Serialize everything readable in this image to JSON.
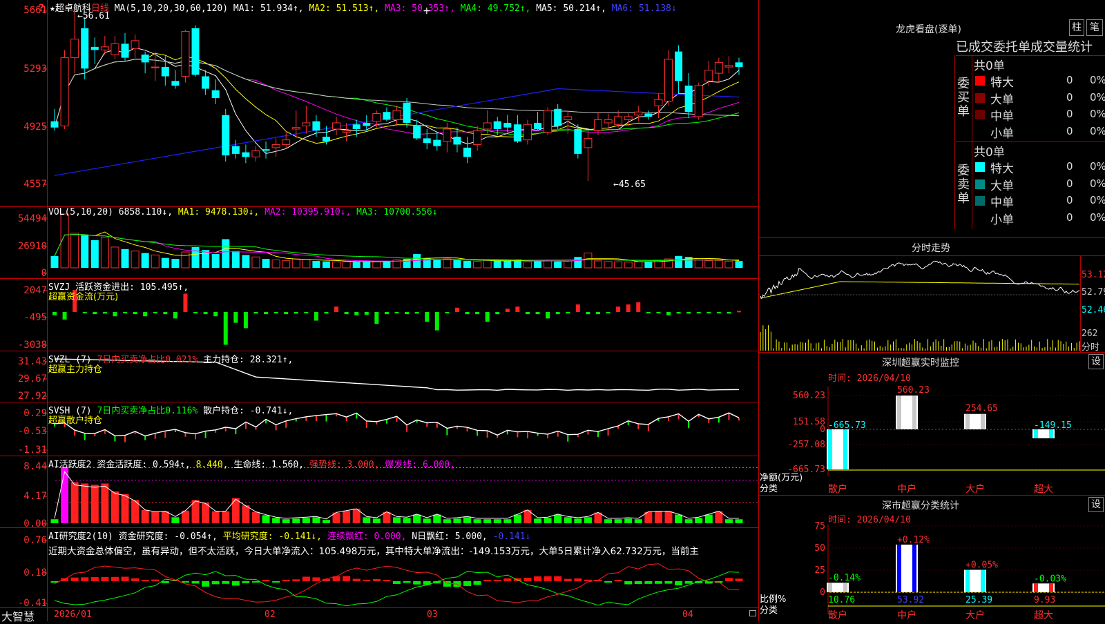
{
  "stock": {
    "star": "★",
    "name": "超卓航科",
    "period": "日线",
    "ma_label": "MA(5,10,20,30,60,120)",
    "ma1": "MA1: 51.934↑,",
    "ma2": "MA2: 51.513↑,",
    "ma3": "MA3: 50.353↑,",
    "ma4": "MA4: 49.752↑,",
    "ma5": "MA5: 50.214↑,",
    "ma6": "MA6: 51.138↓",
    "high_mark": "←56.61",
    "low_mark": "←45.65",
    "plus": "+"
  },
  "axes": {
    "price": [
      "5661",
      "5293",
      "4925",
      "4557"
    ],
    "vol": [
      "54494",
      "26910",
      "0"
    ],
    "svzj": [
      "2047",
      "-495",
      "-3038"
    ],
    "svzl": [
      "31.43",
      "29.67",
      "27.92"
    ],
    "svsh": [
      "0.29",
      "-0.53",
      "-1.31"
    ],
    "active": [
      "8.44",
      "4.17",
      "0.00"
    ],
    "research": [
      "0.76",
      "0.18",
      "-0.41"
    ]
  },
  "vol": {
    "label": "VOL(5,10,20)",
    "value": "6858.110↓,",
    "ma1": "MA1: 9478.130↓,",
    "ma2": "MA2: 10395.910↓,",
    "ma3": "MA3: 10700.556↓"
  },
  "svzj": {
    "label": "SVZJ",
    "text": "活跃资金进出: 105.495↑,",
    "sub": "超赢资金流(万元)"
  },
  "svzl": {
    "label": "SVZL (7)",
    "text1": "7日内买卖净占比0.021%",
    "text2": "主力持仓: 28.321↑,",
    "sub": "超赢主力持仓"
  },
  "svsh": {
    "label": "SVSH (7)",
    "text1": "7日内买卖净占比0.116%",
    "text2": "散户持仓: -0.741↓,",
    "sub": "超赢散户持仓"
  },
  "active": {
    "label": "AI活跃度2",
    "t1": "资金活跃度: 0.594↑,",
    "t2": "8.440,",
    "t3": "生命线: 1.560,",
    "t4": "强势线: 3.000,",
    "t5": "爆发线: 6.000,"
  },
  "research": {
    "label": "AI研究度2(10)",
    "t1": "资金研究度: -0.054↑,",
    "t2": "平均研究度: -0.141↓,",
    "t3": "连续飘红: 0.000,",
    "t4": "N日飘红: 5.000,",
    "t5": "-0.141↓",
    "comment": "近期大资金总体偏空，虽有异动，但不太活跃，今日大单净流入：105.498万元，其中特大单净流出：-149.153万元，大单5日累计净入62.732万元，当前主"
  },
  "dates": [
    "2026/01",
    "02",
    "03",
    "04"
  ],
  "brand": "大智慧",
  "right": {
    "dragon_title": "龙虎看盘(逐单)",
    "btn_zhu": "柱",
    "btn_bi": "笔",
    "deal_title": "已成交委托单成交量统计",
    "buy_side": "委买单",
    "sell_side": "委卖单",
    "buy_total": "共0单",
    "sell_total": "共0单",
    "buy_rows": [
      {
        "label": "特大",
        "count": "0",
        "pct": "0%",
        "color": "#ff0000"
      },
      {
        "label": "大单",
        "count": "0",
        "pct": "0%",
        "color": "#8b0000"
      },
      {
        "label": "中单",
        "count": "0",
        "pct": "0%",
        "color": "#6b0000"
      },
      {
        "label": "小单",
        "count": "0",
        "pct": "0%",
        "color": ""
      }
    ],
    "sell_rows": [
      {
        "label": "特大",
        "count": "0",
        "pct": "0%",
        "color": "#00ffff"
      },
      {
        "label": "大单",
        "count": "0",
        "pct": "0%",
        "color": "#008b8b"
      },
      {
        "label": "中单",
        "count": "0",
        "pct": "0%",
        "color": "#006b6b"
      },
      {
        "label": "小单",
        "count": "0",
        "pct": "0%",
        "color": ""
      }
    ],
    "intraday_title": "分时走势",
    "intraday_prices": [
      "53.12",
      "52.79",
      "52.46"
    ],
    "intraday_vol": [
      "262",
      "分时"
    ],
    "sz_monitor_title": "深圳超赢实时监控",
    "sz_btn": "设",
    "time_label": "时间: 2026/04/10",
    "mon_axis": [
      "560.23",
      "151.58",
      "0",
      "-257.08",
      "-665.73"
    ],
    "mon_ylabel": [
      "净额(万元)",
      "分类"
    ],
    "mon_cats": [
      "散户",
      "中户",
      "大户",
      "超大"
    ],
    "mon_values": [
      "-665.73",
      "560.23",
      "254.65",
      "-149.15"
    ],
    "cls_title": "深市超赢分类统计",
    "cls_btn": "设",
    "cls_time": "时间: 2026/04/10",
    "cls_axis": [
      "75",
      "50",
      "25",
      "0"
    ],
    "cls_ylabel": [
      "比例%",
      "分类"
    ],
    "cls_cats": [
      "散户",
      "中户",
      "大户",
      "超大"
    ],
    "cls_change": [
      "-0.14%",
      "+0.12%",
      "+0.05%",
      "-0.03%"
    ],
    "cls_values": [
      "10.76",
      "53.92",
      "25.39",
      "9.93"
    ]
  },
  "chart_data": [
    {
      "type": "candlestick",
      "title": "超卓航科 日线",
      "y_ticks": [
        56.61,
        52.93,
        49.25,
        45.57
      ],
      "ohlc": [
        [
          49.5,
          50.3,
          48.9,
          49.1
        ],
        [
          49.2,
          54.1,
          49.0,
          53.6
        ],
        [
          53.6,
          56.61,
          52.6,
          54.8
        ],
        [
          55.5,
          56.2,
          52.2,
          52.9
        ],
        [
          54.3,
          54.9,
          53.2,
          54.1
        ],
        [
          54.1,
          55.0,
          53.8,
          54.3
        ],
        [
          53.8,
          55.0,
          53.5,
          54.5
        ],
        [
          54.5,
          55.2,
          53.4,
          53.6
        ],
        [
          54.2,
          55.1,
          53.6,
          54.7
        ],
        [
          53.8,
          54.0,
          52.6,
          53.3
        ],
        [
          53.0,
          54.0,
          52.1,
          53.0
        ],
        [
          53.0,
          53.7,
          51.8,
          52.4
        ],
        [
          52.1,
          52.8,
          51.6,
          51.8
        ],
        [
          52.4,
          55.4,
          52.0,
          55.3
        ],
        [
          55.5,
          55.7,
          52.4,
          52.5
        ],
        [
          52.4,
          52.8,
          51.2,
          51.6
        ],
        [
          51.5,
          52.2,
          50.6,
          51.0
        ],
        [
          49.9,
          50.3,
          46.9,
          47.3
        ],
        [
          47.9,
          48.3,
          47.1,
          47.4
        ],
        [
          47.5,
          48.0,
          46.8,
          47.2
        ],
        [
          47.2,
          47.9,
          46.9,
          47.6
        ],
        [
          47.7,
          48.2,
          47.1,
          47.6
        ],
        [
          47.8,
          48.4,
          47.2,
          48.0
        ],
        [
          48.0,
          48.9,
          47.8,
          48.3
        ],
        [
          49.0,
          50.2,
          48.4,
          49.1
        ],
        [
          49.2,
          50.5,
          48.7,
          49.4
        ],
        [
          49.5,
          49.9,
          48.5,
          48.9
        ],
        [
          48.5,
          49.2,
          48.0,
          48.2
        ],
        [
          49.0,
          49.8,
          48.6,
          49.4
        ],
        [
          48.8,
          49.4,
          48.2,
          48.9
        ],
        [
          49.3,
          49.6,
          48.5,
          49.0
        ],
        [
          49.4,
          49.9,
          48.9,
          49.2
        ],
        [
          49.5,
          50.2,
          49.1,
          50.0
        ],
        [
          50.1,
          50.4,
          49.5,
          49.6
        ],
        [
          49.6,
          50.5,
          49.2,
          50.2
        ],
        [
          50.7,
          51.0,
          49.1,
          49.4
        ],
        [
          49.2,
          49.6,
          48.3,
          48.4
        ],
        [
          48.4,
          49.0,
          47.7,
          48.1
        ],
        [
          48.3,
          48.8,
          47.6,
          47.9
        ],
        [
          48.2,
          49.4,
          47.5,
          49.0
        ],
        [
          48.5,
          49.1,
          47.5,
          48.0
        ],
        [
          47.8,
          48.5,
          46.8,
          47.2
        ],
        [
          48.0,
          49.2,
          47.6,
          48.9
        ],
        [
          49.0,
          50.2,
          48.7,
          49.4
        ],
        [
          49.5,
          49.8,
          48.6,
          49.0
        ],
        [
          49.4,
          49.9,
          48.8,
          49.1
        ],
        [
          49.3,
          49.9,
          48.1,
          48.2
        ],
        [
          48.3,
          49.6,
          48.0,
          49.3
        ],
        [
          49.4,
          50.1,
          48.9,
          49.0
        ],
        [
          48.8,
          50.4,
          48.6,
          50.2
        ],
        [
          50.3,
          50.6,
          49.0,
          49.2
        ],
        [
          49.6,
          50.2,
          48.7,
          49.8
        ],
        [
          49.0,
          49.3,
          47.1,
          47.4
        ],
        [
          47.8,
          48.9,
          45.65,
          48.4
        ],
        [
          48.9,
          50.1,
          48.6,
          49.6
        ],
        [
          49.4,
          50.0,
          48.9,
          49.6
        ],
        [
          49.3,
          50.2,
          49.1,
          49.8
        ],
        [
          49.6,
          50.0,
          49.2,
          49.8
        ],
        [
          49.9,
          50.5,
          49.5,
          50.1
        ],
        [
          50.0,
          50.2,
          49.6,
          49.8
        ],
        [
          50.5,
          51.3,
          49.7,
          50.9
        ],
        [
          50.8,
          54.1,
          50.5,
          53.5
        ],
        [
          54.0,
          54.4,
          51.3,
          52.1
        ],
        [
          51.8,
          52.6,
          49.7,
          50.1
        ],
        [
          49.8,
          52.0,
          49.6,
          51.8
        ],
        [
          52.1,
          53.4,
          51.8,
          52.8
        ],
        [
          52.6,
          53.6,
          52.0,
          53.3
        ],
        [
          53.0,
          53.7,
          52.6,
          53.1
        ],
        [
          53.3,
          53.6,
          52.5,
          53.0
        ]
      ],
      "ma_series": [
        "MA1",
        "MA2",
        "MA3",
        "MA4",
        "MA5",
        "MA6"
      ]
    },
    {
      "type": "bar",
      "title": "VOL(5,10,20)",
      "values": [
        12000,
        54494,
        35000,
        33000,
        28000,
        31000,
        21000,
        19000,
        17000,
        15000,
        13000,
        10000,
        9000,
        16000,
        21000,
        18000,
        14000,
        29000,
        17000,
        13000,
        11000,
        9000,
        8000,
        7500,
        9000,
        8500,
        7000,
        6500,
        6000,
        6200,
        6000,
        6500,
        6200,
        7000,
        8000,
        9000,
        14000,
        10000,
        8500,
        9000,
        8000,
        7000,
        6500,
        7500,
        7000,
        6800,
        8500,
        6000,
        6500,
        7200,
        6400,
        7000,
        11000,
        15000,
        7000,
        6300,
        6000,
        5800,
        6200,
        6000,
        7500,
        9000,
        12000,
        11000,
        8000,
        7200,
        7500,
        6800,
        6858
      ]
    },
    {
      "type": "bar",
      "title": "SVZJ 活跃资金进出",
      "values": [
        -300,
        -700,
        2047,
        -100,
        -200,
        -150,
        -400,
        -100,
        -200,
        -400,
        -100,
        -200,
        -600,
        1700,
        -100,
        -200,
        -400,
        -3038,
        -1000,
        -1500,
        -150,
        -200,
        -100,
        -200,
        -150,
        -100,
        -800,
        -150,
        500,
        -200,
        -300,
        -250,
        -1100,
        -200,
        -100,
        -200,
        -150,
        -900,
        -1700,
        -100,
        400,
        -200,
        -200,
        -900,
        -200,
        300,
        500,
        -200,
        -200,
        -600,
        -200,
        -100,
        700,
        -200,
        -200,
        -100,
        500,
        700,
        900,
        -100,
        -100,
        -300,
        -150,
        -150,
        -100,
        -100,
        -100,
        -150,
        105
      ]
    },
    {
      "type": "line",
      "title": "SVZL 主力持仓",
      "y_ticks": [
        31.43,
        29.67,
        27.92
      ]
    },
    {
      "type": "line",
      "title": "SVSH 散户持仓",
      "y_ticks": [
        0.29,
        -0.53,
        -1.31
      ]
    },
    {
      "type": "bar",
      "title": "AI活跃度2",
      "values": [
        0.6,
        8.44,
        6.2,
        6.0,
        5.8,
        6.0,
        4.8,
        4.4,
        3.5,
        2.0,
        1.7,
        1.8,
        0.9,
        1.9,
        3.5,
        3.1,
        1.8,
        1.8,
        3.8,
        2.7,
        1.7,
        1.2,
        0.8,
        0.6,
        0.7,
        0.8,
        0.9,
        0.5,
        1.6,
        1.9,
        2.2,
        0.9,
        0.7,
        1.7,
        0.9,
        0.8,
        1.3,
        0.7,
        1.3,
        0.6,
        0.7,
        0.9,
        0.6,
        0.6,
        0.6,
        0.6,
        1.3,
        2.0,
        0.7,
        0.8,
        1.3,
        0.9,
        0.7,
        0.9,
        1.6,
        0.6,
        0.6,
        0.7,
        0.6,
        1.7,
        1.8,
        1.8,
        1.3,
        0.6,
        0.8,
        1.3,
        1.8,
        0.6,
        0.594
      ],
      "reference_lines": {
        "生命线": 1.56,
        "强势线": 3.0,
        "爆发线": 6.0
      }
    },
    {
      "type": "bar",
      "title": "AI研究度2(10)",
      "y_ticks": [
        0.76,
        0.18,
        -0.41
      ]
    },
    {
      "type": "bar",
      "title": "深圳超赢实时监控",
      "categories": [
        "散户",
        "中户",
        "大户",
        "超大"
      ],
      "values": [
        -665.73,
        560.23,
        254.65,
        -149.15
      ],
      "ylabel": "净额(万元)",
      "ylim": [
        -665.73,
        560.23
      ]
    },
    {
      "type": "bar",
      "title": "深市超赢分类统计",
      "categories": [
        "散户",
        "中户",
        "大户",
        "超大"
      ],
      "values": [
        10.76,
        53.92,
        25.39,
        9.93
      ],
      "ylabel": "比例%",
      "ylim": [
        0,
        75
      ]
    }
  ]
}
